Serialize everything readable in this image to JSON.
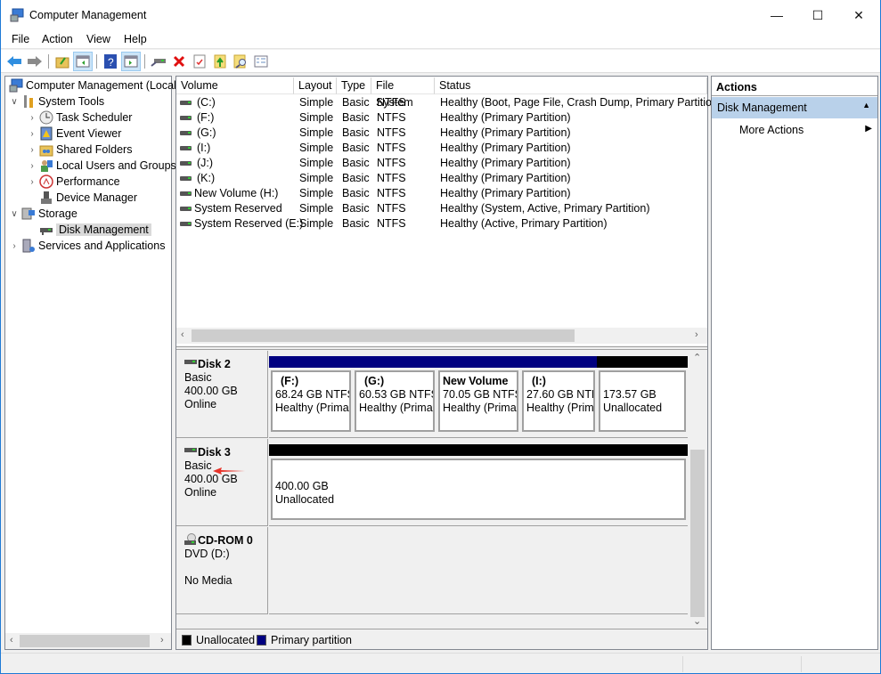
{
  "window": {
    "title": "Computer Management",
    "controls": {
      "minimize": "—",
      "maximize": "☐",
      "close": "✕"
    }
  },
  "menu": [
    "File",
    "Action",
    "View",
    "Help"
  ],
  "toolbar": {
    "buttons": [
      "back",
      "forward",
      "up-folder",
      "show-hide-console-tree",
      "help",
      "show-hide-action-pane",
      "connect-disk",
      "delete",
      "properties",
      "export-up",
      "find",
      "list-view"
    ]
  },
  "tree": {
    "root": "Computer Management (Local",
    "items": [
      {
        "label": "System Tools",
        "icon": "tools-icon",
        "expander": "⌄",
        "level": 1
      },
      {
        "label": "Task Scheduler",
        "icon": "clock-icon",
        "expander": "›",
        "level": 2
      },
      {
        "label": "Event Viewer",
        "icon": "event-viewer-icon",
        "expander": "›",
        "level": 2
      },
      {
        "label": "Shared Folders",
        "icon": "shared-folders-icon",
        "expander": "›",
        "level": 2
      },
      {
        "label": "Local Users and Groups",
        "icon": "users-icon",
        "expander": "›",
        "level": 2
      },
      {
        "label": "Performance",
        "icon": "performance-icon",
        "expander": "›",
        "level": 2
      },
      {
        "label": "Device Manager",
        "icon": "device-manager-icon",
        "expander": "",
        "level": 2
      },
      {
        "label": "Storage",
        "icon": "storage-icon",
        "expander": "⌄",
        "level": 1
      },
      {
        "label": "Disk Management",
        "icon": "disk-icon",
        "expander": "",
        "level": 2,
        "selected": true
      },
      {
        "label": "Services and Applications",
        "icon": "services-icon",
        "expander": "›",
        "level": 1
      }
    ]
  },
  "volumes": {
    "columns": [
      "Volume",
      "Layout",
      "Type",
      "File System",
      "Status"
    ],
    "rows": [
      {
        "volume": "(C:)",
        "layout": "Simple",
        "type": "Basic",
        "fs": "NTFS",
        "status": "Healthy (Boot, Page File, Crash Dump, Primary Partition)"
      },
      {
        "volume": "(F:)",
        "layout": "Simple",
        "type": "Basic",
        "fs": "NTFS",
        "status": "Healthy (Primary Partition)"
      },
      {
        "volume": "(G:)",
        "layout": "Simple",
        "type": "Basic",
        "fs": "NTFS",
        "status": "Healthy (Primary Partition)"
      },
      {
        "volume": "(I:)",
        "layout": "Simple",
        "type": "Basic",
        "fs": "NTFS",
        "status": "Healthy (Primary Partition)"
      },
      {
        "volume": "(J:)",
        "layout": "Simple",
        "type": "Basic",
        "fs": "NTFS",
        "status": "Healthy (Primary Partition)"
      },
      {
        "volume": "(K:)",
        "layout": "Simple",
        "type": "Basic",
        "fs": "NTFS",
        "status": "Healthy (Primary Partition)"
      },
      {
        "volume": "New Volume (H:)",
        "layout": "Simple",
        "type": "Basic",
        "fs": "NTFS",
        "status": "Healthy (Primary Partition)"
      },
      {
        "volume": "System Reserved",
        "layout": "Simple",
        "type": "Basic",
        "fs": "NTFS",
        "status": "Healthy (System, Active, Primary Partition)"
      },
      {
        "volume": "System Reserved (E:)",
        "layout": "Simple",
        "type": "Basic",
        "fs": "NTFS",
        "status": "Healthy (Active, Primary Partition)"
      }
    ]
  },
  "disks": [
    {
      "name": "Disk 2",
      "type": "Basic",
      "size": "400.00 GB",
      "state": "Online",
      "partitions": [
        {
          "title": "(F:)",
          "line1": "68.24 GB NTFS",
          "line2": "Healthy (Prima",
          "kind": "primary"
        },
        {
          "title": "(G:)",
          "line1": "60.53 GB NTFS",
          "line2": "Healthy (Prima",
          "kind": "primary"
        },
        {
          "title": "New Volume",
          "line1": "70.05 GB NTFS",
          "line2": "Healthy (Prima",
          "kind": "primary"
        },
        {
          "title": "(I:)",
          "line1": "27.60 GB NTF",
          "line2": "Healthy (Prim",
          "kind": "primary"
        },
        {
          "title": "",
          "line1": "173.57 GB",
          "line2": "Unallocated",
          "kind": "unallocated"
        }
      ]
    },
    {
      "name": "Disk 3",
      "type": "Basic",
      "size": "400.00 GB",
      "state": "Online",
      "partitions": [
        {
          "title": "",
          "line1": "400.00 GB",
          "line2": "Unallocated",
          "kind": "unallocated"
        }
      ]
    },
    {
      "name": "CD-ROM 0",
      "type": "DVD (D:)",
      "size": "",
      "state": "No Media",
      "partitions": []
    }
  ],
  "legend": [
    {
      "label": "Unallocated",
      "color": "#000000"
    },
    {
      "label": "Primary partition",
      "color": "#000080"
    }
  ],
  "colors": {
    "primary": "#000080",
    "unallocated": "#000000",
    "action_section": "#b9d1ea",
    "annotation_arrow": "#e8332a"
  },
  "actions": {
    "header": "Actions",
    "section": "Disk Management",
    "items": [
      "More Actions"
    ]
  }
}
